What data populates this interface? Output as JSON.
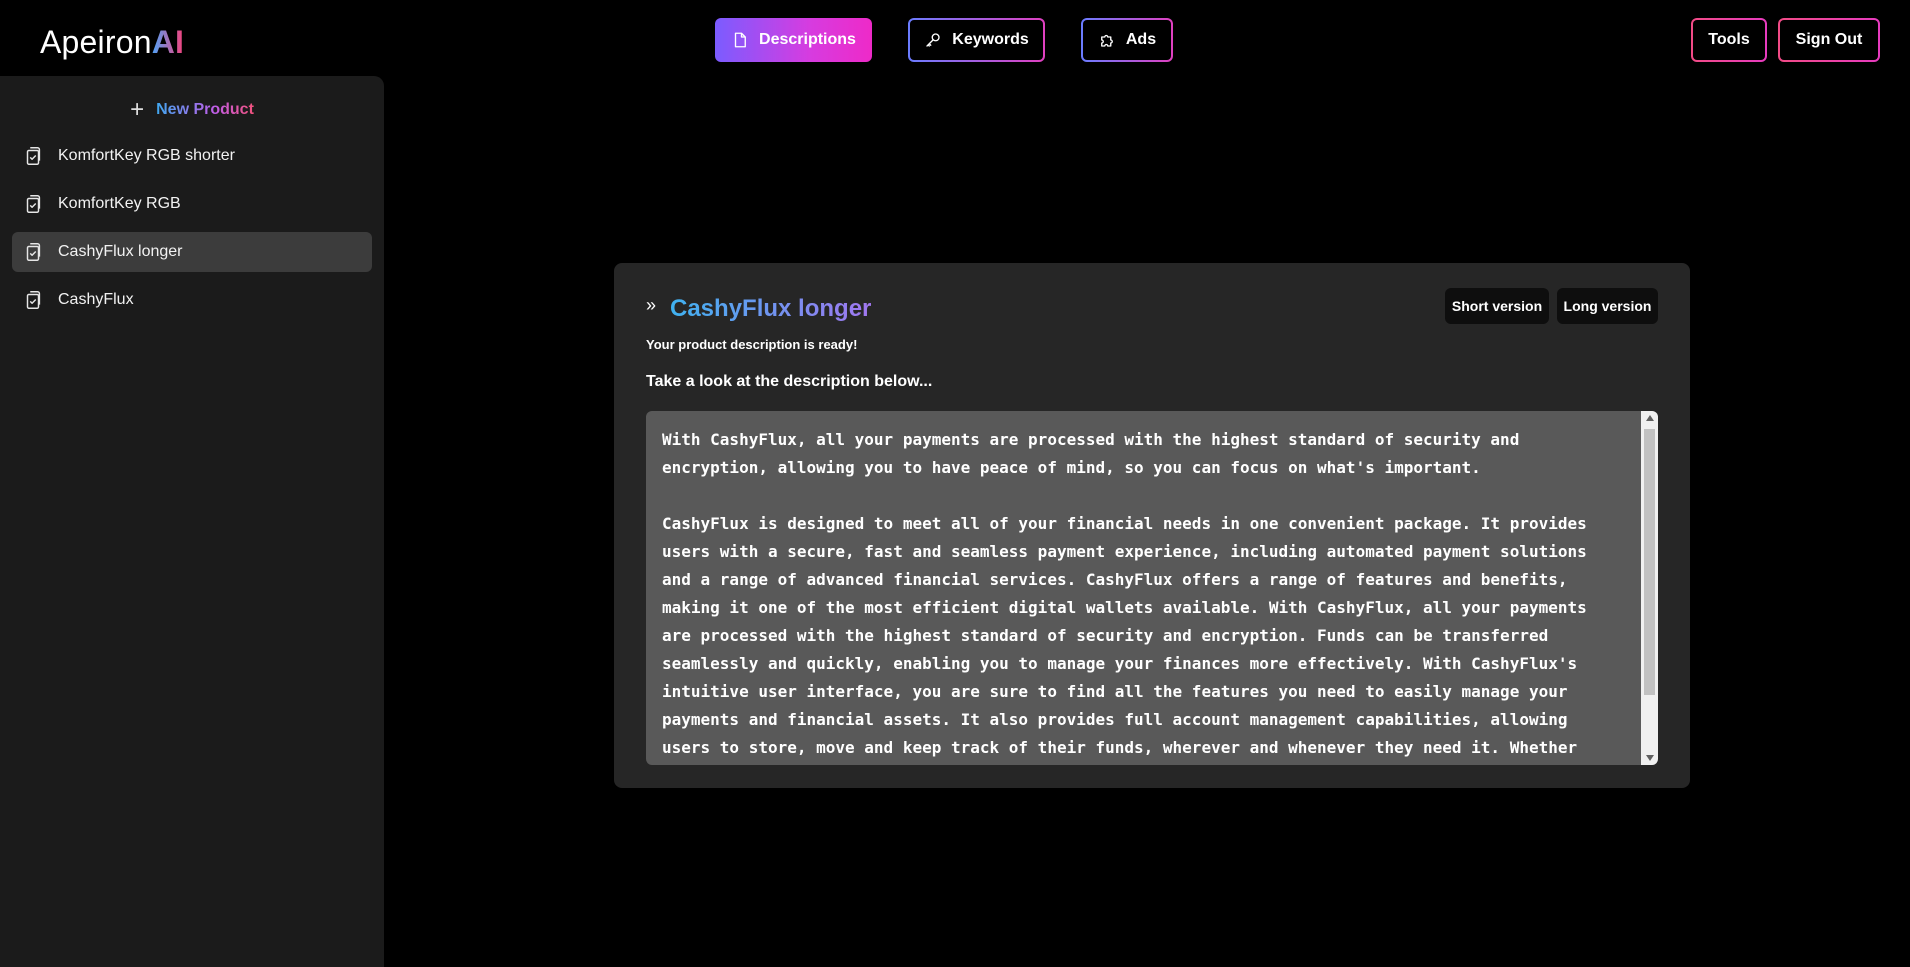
{
  "app": {
    "logo_main": "Apeiron",
    "logo_accent": "AI"
  },
  "header": {
    "nav": [
      {
        "label": "Descriptions",
        "icon": "document-icon",
        "active": true
      },
      {
        "label": "Keywords",
        "icon": "key-icon",
        "active": false
      },
      {
        "label": "Ads",
        "icon": "puzzle-icon",
        "active": false
      }
    ],
    "tools_label": "Tools",
    "signout_label": "Sign Out"
  },
  "sidebar": {
    "new_product_label": "New Product",
    "items": [
      {
        "label": "KomfortKey RGB shorter",
        "icon": "clipboard-check-icon",
        "selected": false
      },
      {
        "label": "KomfortKey RGB",
        "icon": "clipboard-check-icon",
        "selected": false
      },
      {
        "label": "CashyFlux longer",
        "icon": "clipboard-check-icon",
        "selected": true
      },
      {
        "label": "CashyFlux",
        "icon": "clipboard-check-icon",
        "selected": false
      }
    ]
  },
  "card": {
    "title": "CashyFlux longer",
    "short_version_label": "Short version",
    "long_version_label": "Long version",
    "ready_text": "Your product description is ready!",
    "look_text": "Take a look at the description below...",
    "description": "With CashyFlux, all your payments are processed with the highest standard of security and encryption, allowing you to have peace of mind, so you can focus on what's important.\n\nCashyFlux is designed to meet all of your financial needs in one convenient package. It provides users with a secure, fast and seamless payment experience, including automated payment solutions and a range of advanced financial services. CashyFlux offers a range of features and benefits, making it one of the most efficient digital wallets available. With CashyFlux, all your payments are processed with the highest standard of security and encryption. Funds can be transferred seamlessly and quickly, enabling you to manage your finances more effectively. With CashyFlux's intuitive user interface, you are sure to find all the features you need to easily manage your payments and financial assets. It also provides full account management capabilities, allowing users to store, move and keep track of their funds, wherever and whenever they need it. Whether"
  },
  "colors": {
    "background": "#000000",
    "sidebar": "#1b1b1b",
    "card": "#262626",
    "textarea": "#595959",
    "accent_gradient_start": "#7b5cff",
    "accent_gradient_end": "#ee2ac8"
  }
}
